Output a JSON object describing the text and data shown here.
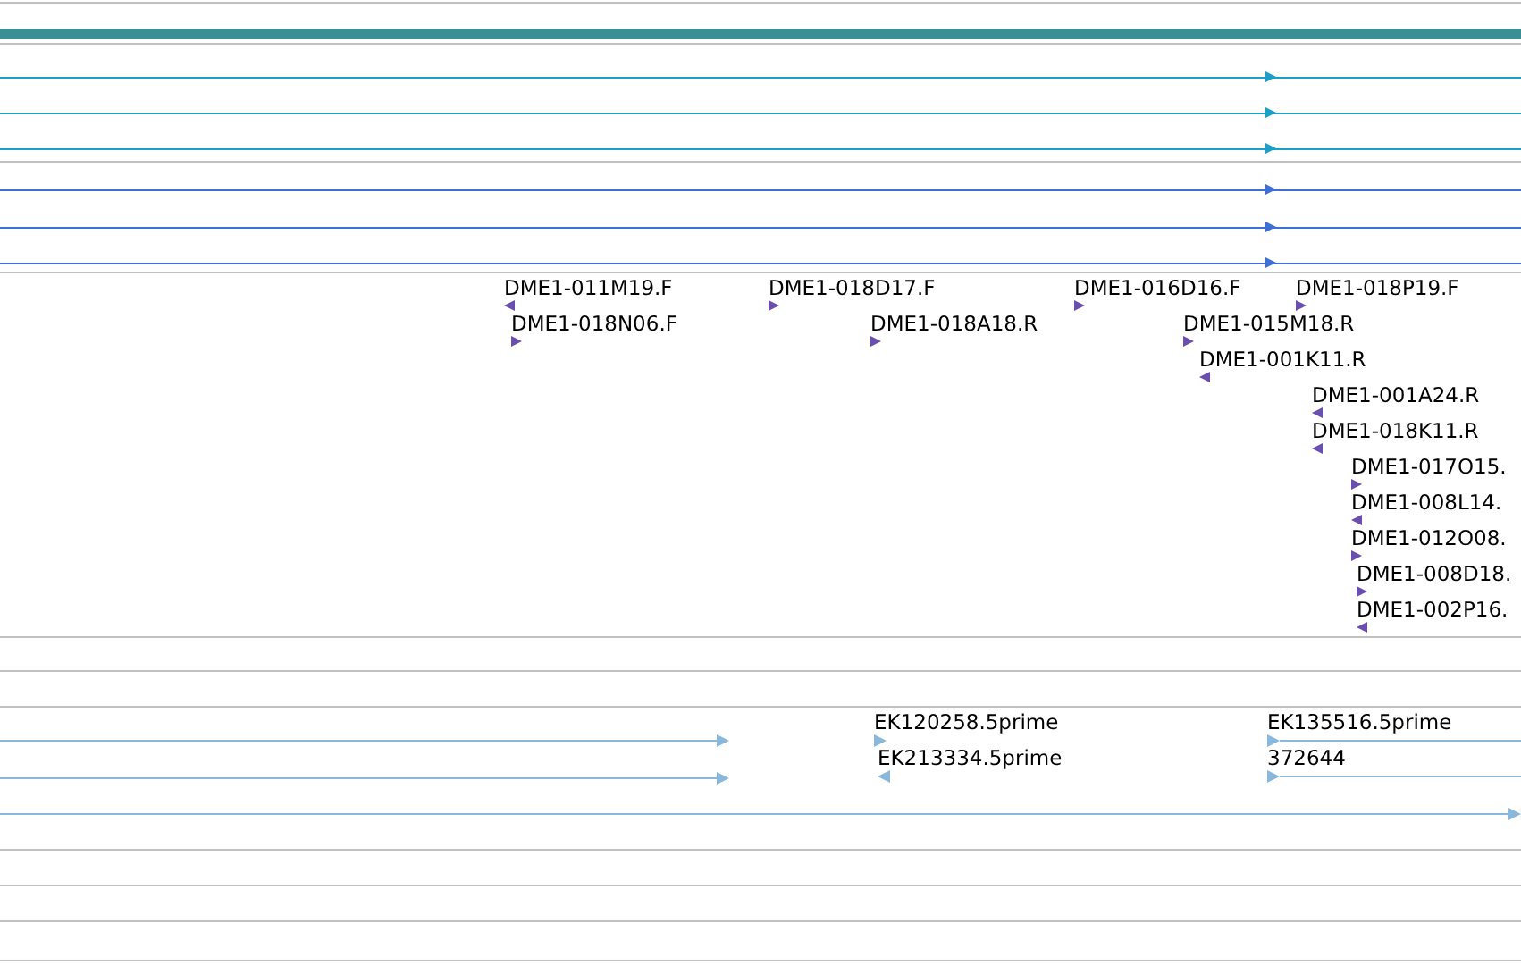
{
  "alignments": [
    {
      "reverse": false,
      "color": "#1ba1c6"
    },
    {
      "reverse": false,
      "color": "#1ba1c6"
    },
    {
      "reverse": false,
      "color": "#1ba1c6"
    },
    {
      "reverse": false,
      "color": "#3d6fd6"
    },
    {
      "reverse": false,
      "color": "#3d6fd6"
    },
    {
      "reverse": false,
      "color": "#3d6fd6"
    }
  ],
  "clones": [
    {
      "label": "DME1-011M19.F",
      "reverse": true
    },
    {
      "label": "DME1-018D17.F",
      "reverse": false
    },
    {
      "label": "DME1-016D16.F",
      "reverse": false
    },
    {
      "label": "DME1-018P19.F",
      "reverse": false
    },
    {
      "label": "DME1-018N06.F",
      "reverse": false
    },
    {
      "label": "DME1-018A18.R",
      "reverse": false
    },
    {
      "label": "DME1-015M18.R",
      "reverse": false
    },
    {
      "label": "DME1-001K11.R",
      "reverse": true
    },
    {
      "label": "DME1-001A24.R",
      "reverse": true
    },
    {
      "label": "DME1-018K11.R",
      "reverse": true
    },
    {
      "label": "DME1-017O15.",
      "reverse": false
    },
    {
      "label": "DME1-008L14.",
      "reverse": true
    },
    {
      "label": "DME1-012O08.",
      "reverse": false
    },
    {
      "label": "DME1-008D18.",
      "reverse": false
    },
    {
      "label": "DME1-002P16.",
      "reverse": true
    }
  ],
  "ests": [
    {
      "label": "EK120258.5prime",
      "reverse": false
    },
    {
      "label": "EK135516.5prime",
      "reverse": false
    },
    {
      "label": "EK213334.5prime",
      "reverse": true
    },
    {
      "label": "372644",
      "reverse": false
    }
  ],
  "est_unlabeled": [
    {
      "reverse": false
    },
    {
      "reverse": false
    },
    {
      "reverse": false
    }
  ]
}
